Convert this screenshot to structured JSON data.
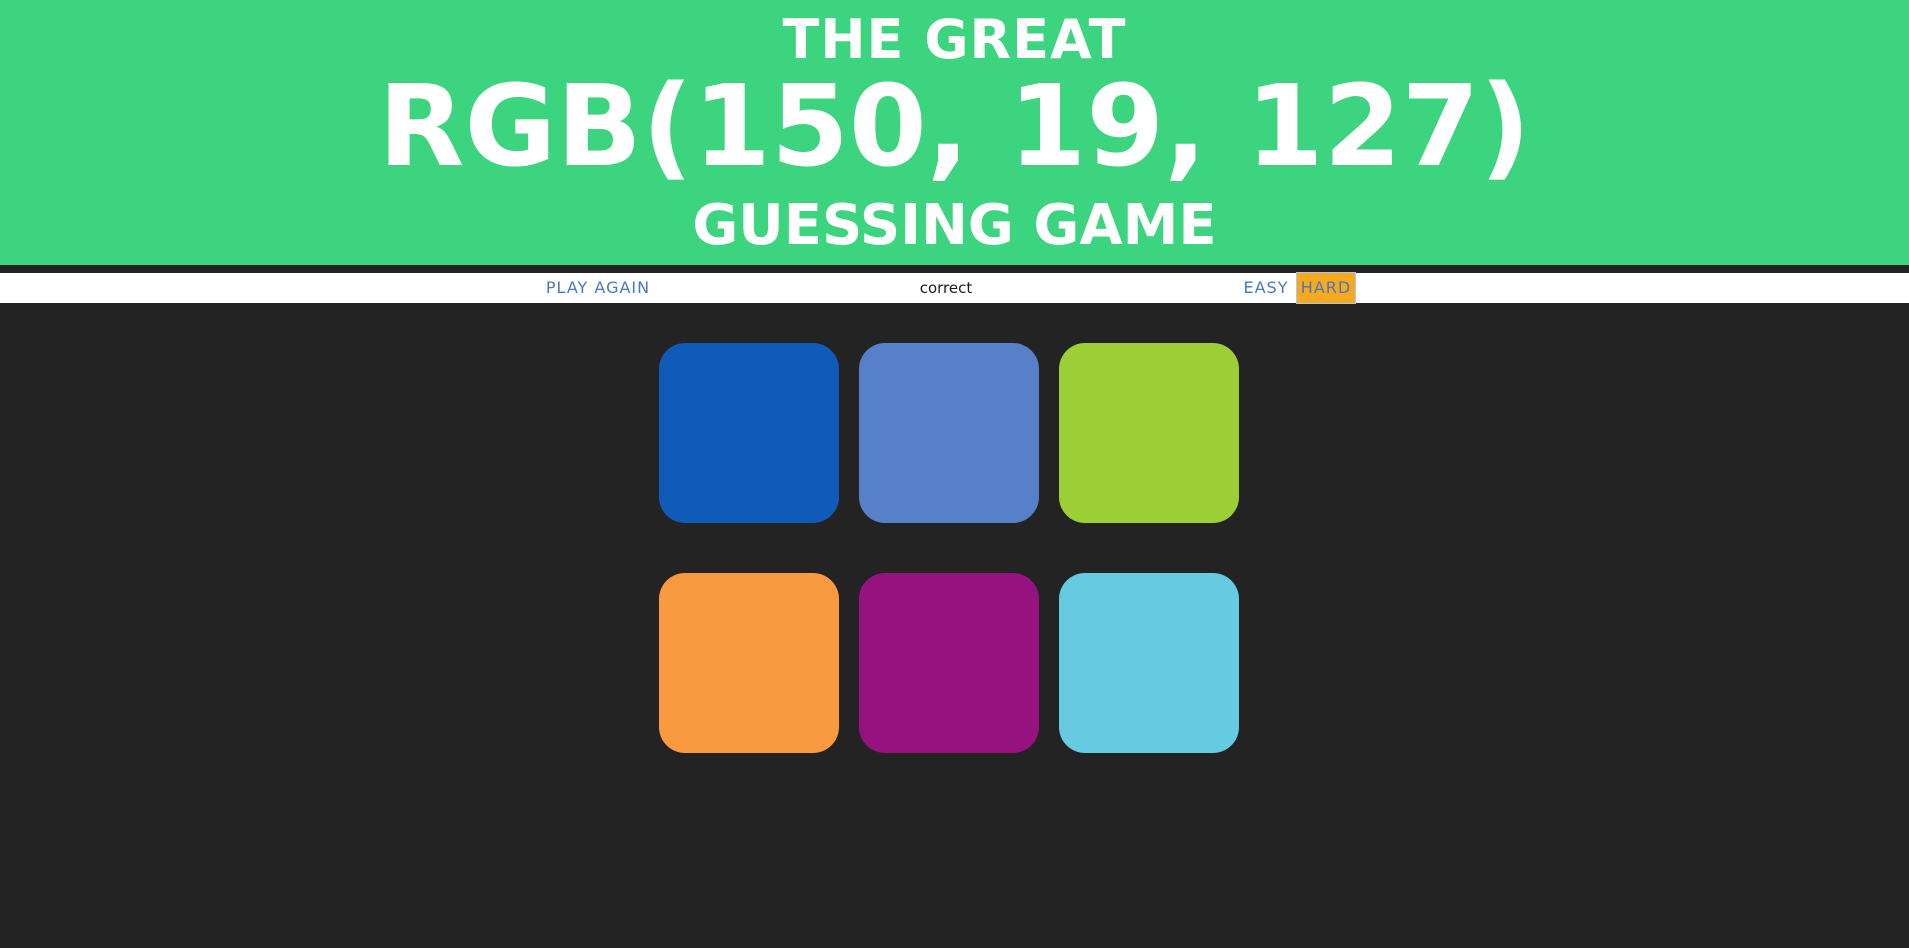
{
  "header": {
    "line1": "THE GREAT",
    "rgb_display": "RGB(150, 19, 127)",
    "line3": "GUESSING GAME",
    "background_color": "#3dd47f"
  },
  "stripe": {
    "reset_label": "PLAY AGAIN",
    "message": "correct",
    "easy_label": "EASY",
    "hard_label": "HARD",
    "selected_mode": "HARD"
  },
  "squares": [
    {
      "color": "#0f5bb7"
    },
    {
      "color": "#5681c8"
    },
    {
      "color": "#9ccf35"
    },
    {
      "color": "#f99a40"
    },
    {
      "color": "#96137f"
    },
    {
      "color": "#66cbe0"
    }
  ],
  "page_background": "#232323"
}
